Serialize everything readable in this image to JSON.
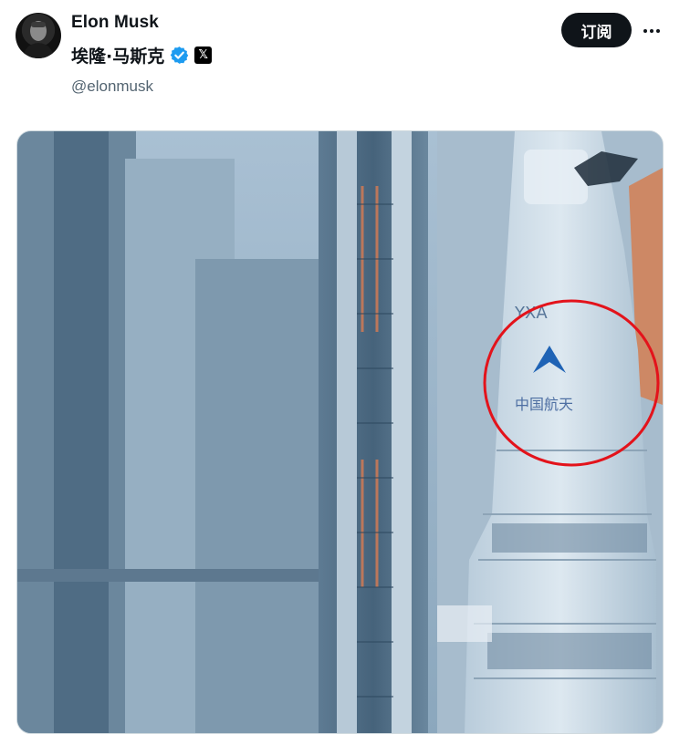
{
  "tweet": {
    "author": {
      "display_name": "Elon Musk",
      "alt_name": "埃隆·马斯克",
      "handle": "@elonmusk",
      "verified_icon": "verified-check-icon",
      "affiliation_icon": "x-logo-icon",
      "affiliation_glyph": "𝕏"
    },
    "actions": {
      "subscribe_label": "订阅",
      "more_icon": "more-horizontal-icon"
    },
    "media": {
      "description_icon": "rocket-photo",
      "highlight_color": "#e3131b"
    }
  },
  "colors": {
    "text_primary": "#0f1419",
    "text_secondary": "#536471",
    "verified_blue": "#1d9bf0",
    "button_dark": "#0f1419"
  }
}
